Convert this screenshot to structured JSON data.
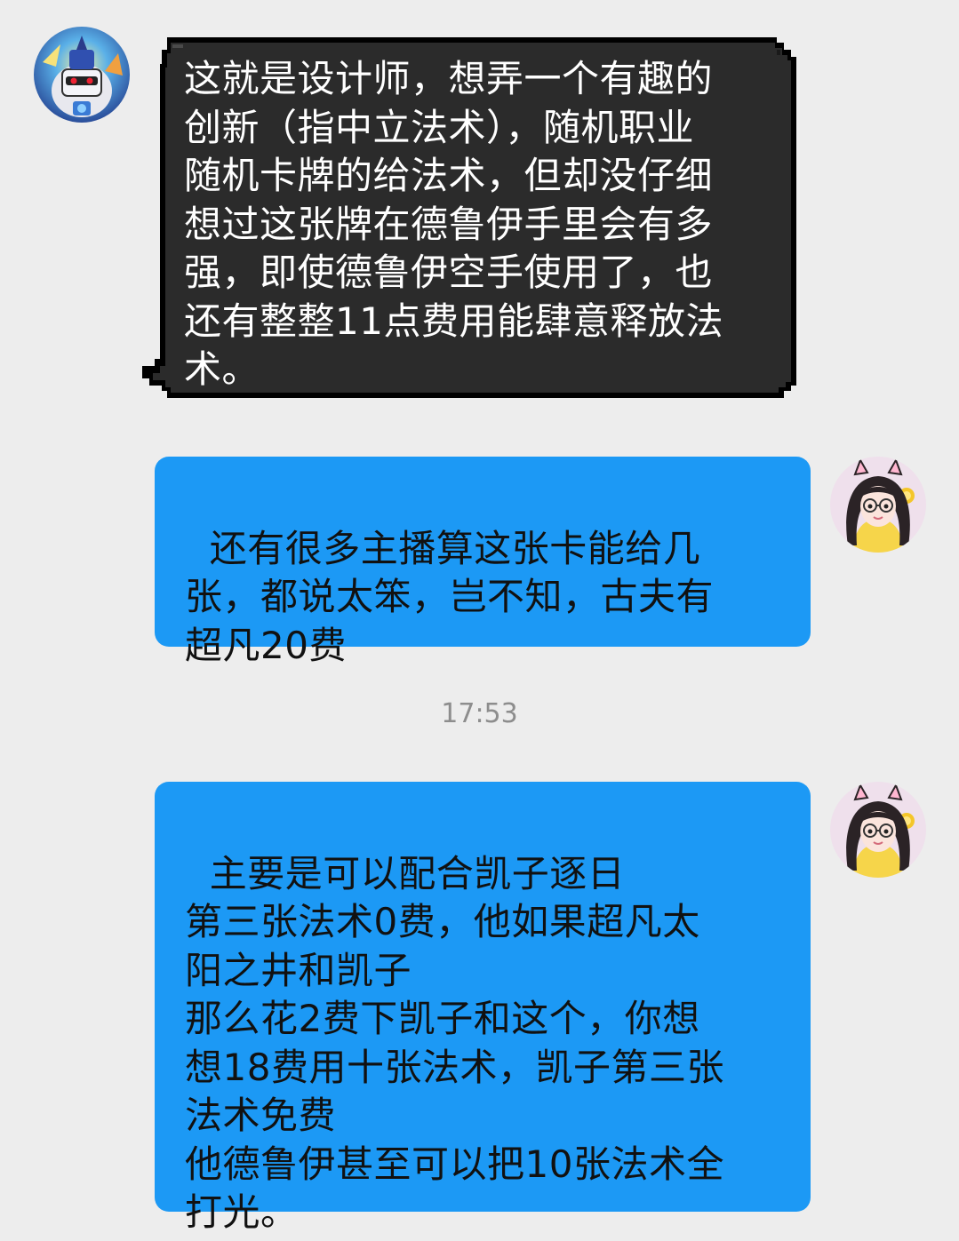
{
  "messages": [
    {
      "from": "other",
      "text": "这就是设计师，想弄一个有趣的\n创新（指中立法术），随机职业\n随机卡牌的给法术，但却没仔细\n想过这张牌在德鲁伊手里会有多\n强，即使德鲁伊空手使用了，也\n还有整整11点费用能肆意释放法\n术。"
    },
    {
      "from": "self",
      "text": "还有很多主播算这张卡能给几\n张，都说太笨，岂不知，古夫有\n超凡20费"
    },
    {
      "from": "self",
      "text": "主要是可以配合凯子逐日\n第三张法术0费，他如果超凡太\n阳之井和凯子\n那么花2费下凯子和这个，你想\n想18费用十张法术，凯子第三张\n法术免费\n他德鲁伊甚至可以把10张法术全\n打光。"
    }
  ],
  "timestamp": "17:53",
  "colors": {
    "background": "#ededed",
    "self_bubble": "#1c99f5",
    "other_bubble": "#2b2b2b",
    "timestamp": "#8d8d8d"
  },
  "icons": {
    "other_avatar": "robot-mummy-avatar-icon",
    "self_avatar": "girl-cat-ears-avatar-icon"
  }
}
